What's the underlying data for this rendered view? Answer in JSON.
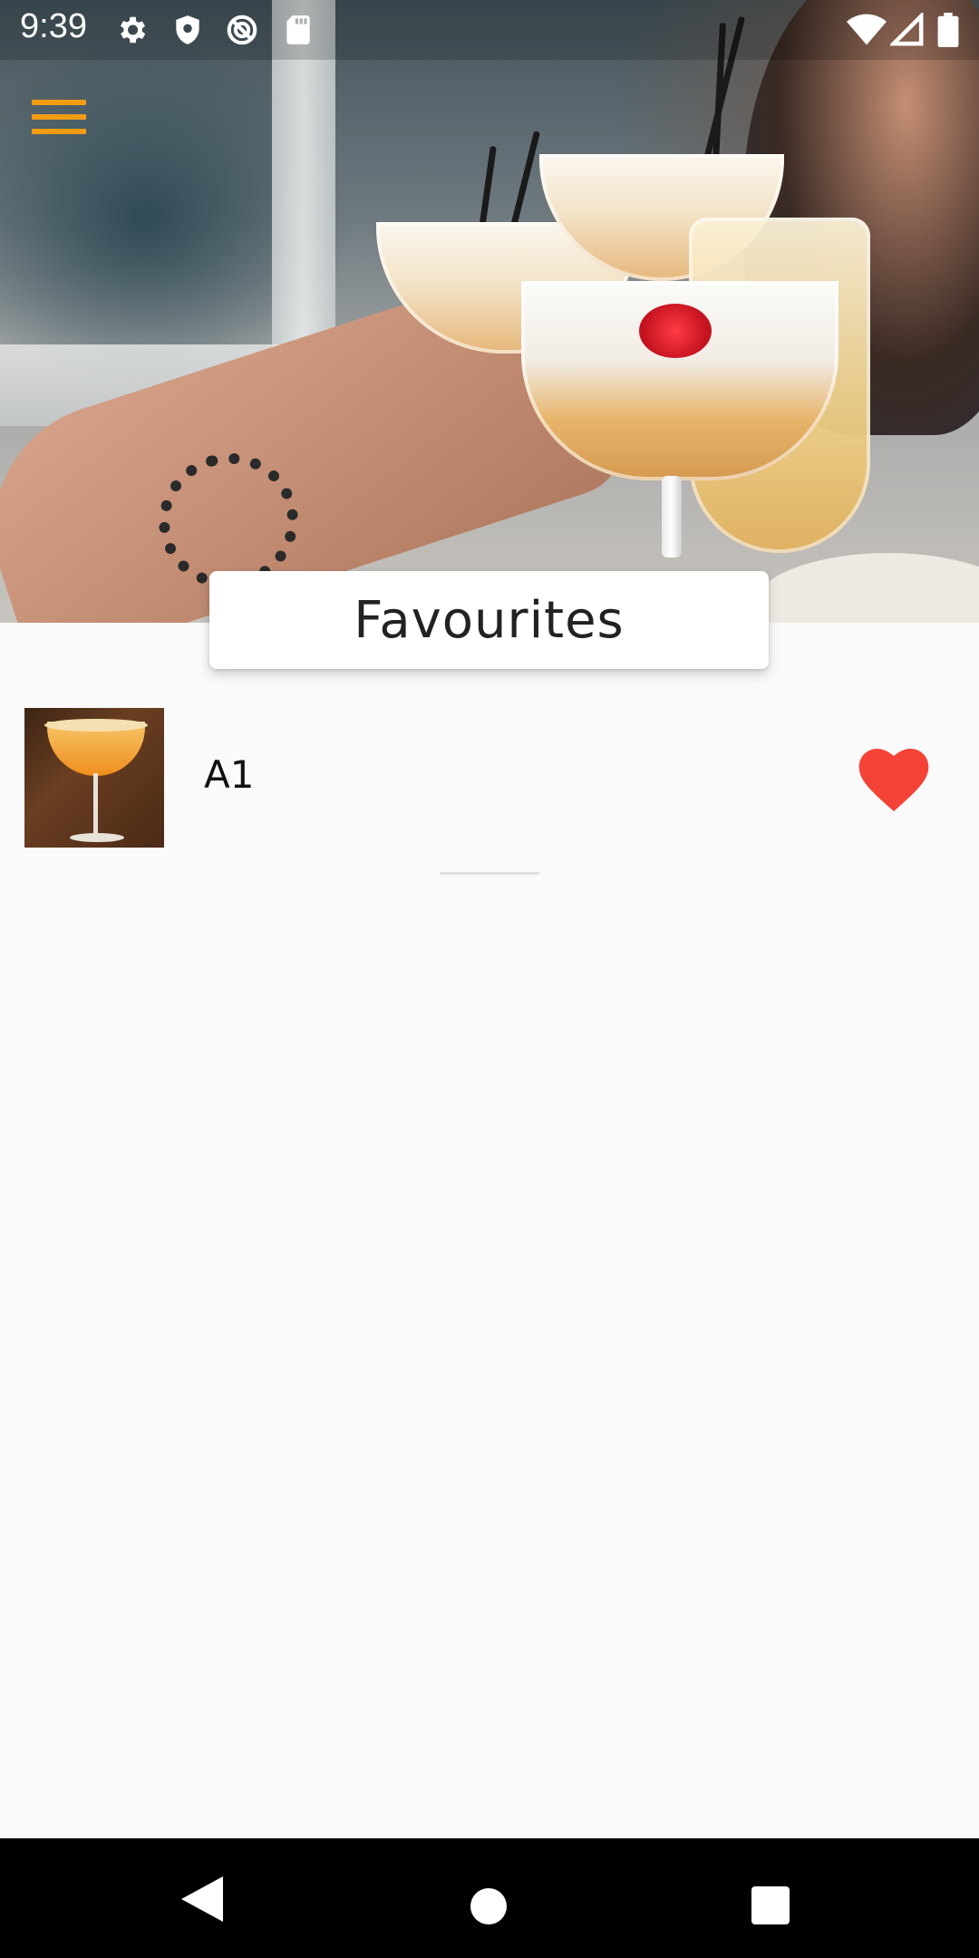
{
  "status_bar": {
    "time": "9:39",
    "icons": [
      "settings-icon",
      "shield-icon",
      "vpn-icon",
      "sd-card-icon"
    ],
    "right_icons": [
      "wifi-icon",
      "cell-signal-icon",
      "battery-icon"
    ]
  },
  "header": {
    "menu_icon": "hamburger-menu-icon",
    "title": "Favourites"
  },
  "favourites": [
    {
      "name": "A1",
      "thumbnail": "cocktail-photo",
      "favourite": true
    }
  ],
  "colors": {
    "accent": "#f39c12",
    "heart": "#f44336",
    "background": "#fafafa"
  },
  "nav_bar": {
    "buttons": [
      "back",
      "home",
      "recents"
    ]
  }
}
